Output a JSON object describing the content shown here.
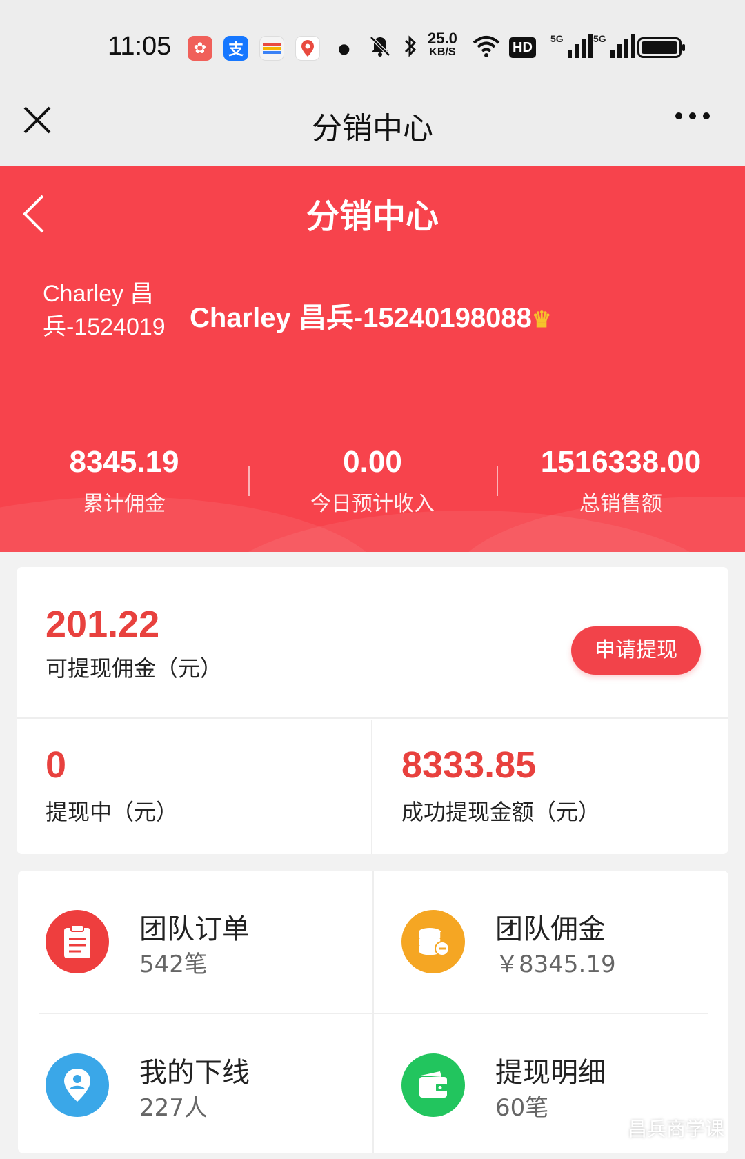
{
  "status_bar": {
    "time": "11:05",
    "speed_value": "25.0",
    "speed_unit": "KB/S",
    "hd_label": "HD",
    "signal_1_label": "5G",
    "signal_2_label": "5G"
  },
  "webview": {
    "title": "分销中心"
  },
  "hero": {
    "title": "分销中心",
    "avatar_alt": "Charley 昌兵-1524019",
    "username": "Charley 昌兵-15240198088",
    "stats": [
      {
        "value": "8345.19",
        "label": "累计佣金"
      },
      {
        "value": "0.00",
        "label": "今日预计收入"
      },
      {
        "value": "1516338.00",
        "label": "总销售额"
      }
    ]
  },
  "withdraw": {
    "available_amount": "201.22",
    "available_label": "可提现佣金（元）",
    "apply_button": "申请提现",
    "pending_amount": "0",
    "pending_label": "提现中（元）",
    "success_amount": "8333.85",
    "success_label": "成功提现金额（元）"
  },
  "menu": [
    {
      "title": "团队订单",
      "sub": "542笔",
      "icon": "clipboard-icon",
      "color": "#ee3e3e"
    },
    {
      "title": "团队佣金",
      "sub": "￥8345.19",
      "icon": "coins-icon",
      "color": "#f5a623"
    },
    {
      "title": "我的下线",
      "sub": "227人",
      "icon": "user-pin-icon",
      "color": "#3aa7e8"
    },
    {
      "title": "提现明细",
      "sub": "60笔",
      "icon": "wallet-icon",
      "color": "#22c55e"
    }
  ],
  "watermark": "昌兵商学课"
}
